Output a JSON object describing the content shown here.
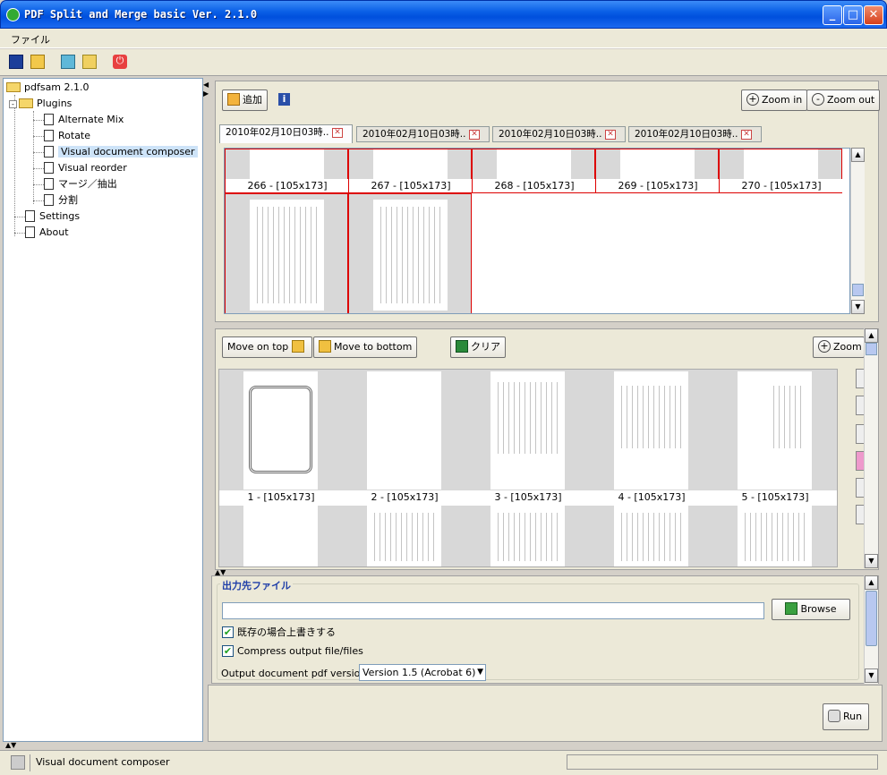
{
  "window": {
    "title": "PDF Split and Merge basic Ver. 2.1.0"
  },
  "menu": {
    "file": "ファイル"
  },
  "toolbar": {
    "icons": [
      "save-icon",
      "open-icon",
      "layout-icon",
      "clean-icon",
      "power-icon"
    ]
  },
  "sidebar": {
    "root": "pdfsam 2.1.0",
    "plugins": "Plugins",
    "items": [
      "Alternate Mix",
      "Rotate",
      "Visual document composer",
      "Visual reorder",
      "マージ／抽出",
      "分割"
    ],
    "selected": "Visual document composer",
    "settings": "Settings",
    "about": "About"
  },
  "top": {
    "add_label": "追加",
    "zoom_in": "Zoom in",
    "zoom_out": "Zoom out",
    "tabs": [
      "2010年02月10日03時..",
      "2010年02月10日03時..",
      "2010年02月10日03時..",
      "2010年02月10日03時.."
    ],
    "thumbs": [
      "266 - [105x173]",
      "267 - [105x173]",
      "268 - [105x173]",
      "269 - [105x173]",
      "270 - [105x173]"
    ]
  },
  "bottom": {
    "move_top": "Move on top",
    "move_bottom": "Move to bottom",
    "clear": "クリア",
    "zoom": "Zoom",
    "thumbs": [
      "1 - [105x173]",
      "2 - [105x173]",
      "3 - [105x173]",
      "4 - [105x173]",
      "5 - [105x173]"
    ]
  },
  "output": {
    "legend": "出力先ファイル",
    "path_value": "",
    "browse": "Browse",
    "overwrite": "既存の場合上書きする",
    "compress": "Compress output file/files",
    "version_label": "Output document pdf version:",
    "version_value": "Version 1.5 (Acrobat 6)",
    "run": "Run"
  },
  "status": {
    "text": "Visual document composer"
  }
}
